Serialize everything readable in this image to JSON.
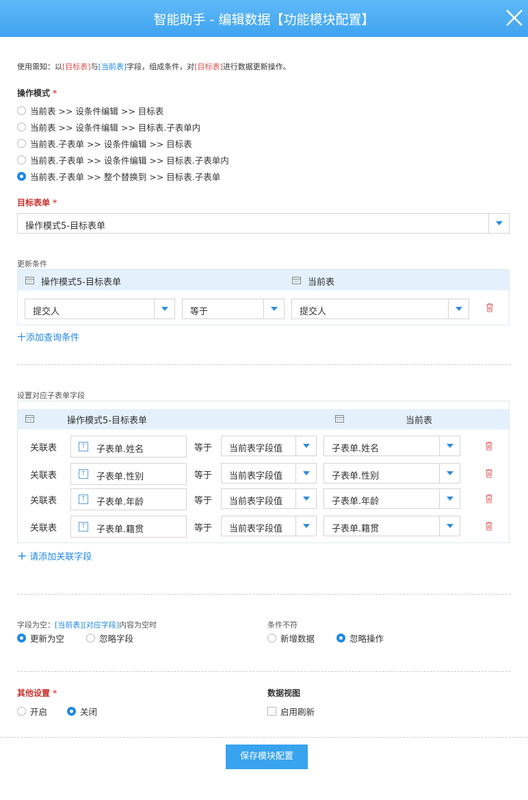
{
  "header": {
    "title": "智能助手 - 编辑数据【功能模块配置】"
  },
  "notice": {
    "prefix": "使用需知：以",
    "target1": "[目标表]",
    "mid1": "与",
    "current": "[当前表]",
    "mid2": "字段，组成条件，对",
    "target2": "[目标表]",
    "suffix": "进行数据更新操作。"
  },
  "op_mode": {
    "label": "操作模式",
    "options": [
      "当前表 >> 设条件编辑 >> 目标表",
      "当前表 >> 设条件编辑 >> 目标表.子表单内",
      "当前表.子表单 >> 设条件编辑 >> 目标表",
      "当前表.子表单 >> 设条件编辑 >> 目标表.子表单内",
      "当前表.子表单 >> 整个替换到 >> 目标表.子表单"
    ],
    "selected_index": 4
  },
  "target_form": {
    "label": "目标表单",
    "value": "操作模式5-目标表单"
  },
  "update_cond": {
    "label": "更新条件",
    "head_left": "操作模式5-目标表单",
    "head_right": "当前表",
    "row": {
      "field": "提交人",
      "op": "等于",
      "value": "提交人"
    },
    "add_label": "十添加查询条件"
  },
  "subform": {
    "label": "设置对应子表单字段",
    "head_left": "操作模式5-目标表单",
    "head_right": "当前表",
    "rows": [
      {
        "rel": "关联表",
        "field": "子表单.姓名",
        "op": "等于",
        "src": "当前表字段值",
        "value": "子表单.姓名"
      },
      {
        "rel": "关联表",
        "field": "子表单.性别",
        "op": "等于",
        "src": "当前表字段值",
        "value": "子表单.性别"
      },
      {
        "rel": "关联表",
        "field": "子表单.年龄",
        "op": "等于",
        "src": "当前表字段值",
        "value": "子表单.年龄"
      },
      {
        "rel": "关联表",
        "field": "子表单.籍贯",
        "op": "等于",
        "src": "当前表字段值",
        "value": "子表单.籍贯"
      }
    ],
    "add_label": "请添加关联字段"
  },
  "empty_field": {
    "prefix": "字段为空：",
    "highlight": "[当前表][对应字段]",
    "suffix": "内容为空时",
    "options": [
      "更新为空",
      "忽略字段"
    ],
    "selected_index": 0
  },
  "mismatch": {
    "label": "条件不符",
    "options": [
      "新增数据",
      "忽略操作"
    ],
    "selected_index": 1
  },
  "other": {
    "label": "其他设置",
    "options": [
      "开启",
      "关闭"
    ],
    "selected_index": 1
  },
  "data_view": {
    "label": "数据视图",
    "checkbox_label": "启用刷新",
    "checked": false
  },
  "save_button": "保存模块配置",
  "colors": {
    "accent": "#1e88e5",
    "header": "#3ea3ef",
    "danger": "#d9534f"
  }
}
